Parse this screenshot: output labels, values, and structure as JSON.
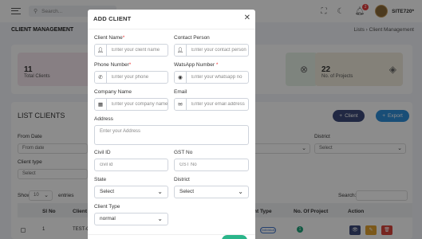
{
  "topbar": {
    "search_placeholder": "Search...",
    "notification_count": "2",
    "user_name": "SITE720*"
  },
  "page": {
    "title": "CLIENT MANAGEMENT",
    "breadcrumb": "Lists  ›  Client Management"
  },
  "stats": [
    {
      "value": "11",
      "label": "Total Clients"
    },
    {
      "value": "22",
      "label": "No. of Projects"
    }
  ],
  "list": {
    "title": "LIST CLIENTS",
    "add_button": "Client",
    "export_button": "Export",
    "filters": {
      "from_date_label": "From Date",
      "from_date_placeholder": "From date",
      "district_label": "District",
      "district_value": "Select",
      "client_type_label": "Client type",
      "client_type_value": "Select"
    },
    "show_label": "Show",
    "show_value": "10",
    "entries_label": "entries",
    "search_label": "Search:",
    "columns": [
      "Sl No",
      "Client N",
      "nt Type",
      "No. Of Project",
      "Action"
    ],
    "rows": [
      {
        "sl": "1",
        "name": "TEST-C",
        "type": "Individual",
        "projects": "1"
      }
    ]
  },
  "modal": {
    "title": "ADD CLIENT",
    "fields": {
      "client_name": {
        "label": "Client Name",
        "placeholder": "Enter your client name"
      },
      "contact_person": {
        "label": "Contact Person",
        "placeholder": "Enter your contact person"
      },
      "phone": {
        "label": "Phone Number",
        "placeholder": "Enter your phone"
      },
      "whatsapp": {
        "label": "WatsApp Number ",
        "placeholder": "Enter your whatsapp no"
      },
      "company": {
        "label": "Company Name",
        "placeholder": "Enter your company name"
      },
      "email": {
        "label": "Email",
        "placeholder": "Enter your email address"
      },
      "address": {
        "label": "Address",
        "placeholder": "Enter your Address"
      },
      "civil_id": {
        "label": "Civil ID",
        "placeholder": "civil id"
      },
      "gst": {
        "label": "GST No",
        "placeholder": "GST No"
      },
      "state": {
        "label": "State",
        "value": "Select"
      },
      "district": {
        "label": "District",
        "value": "Select"
      },
      "client_type": {
        "label": "Client Type",
        "value": "normal"
      }
    }
  }
}
